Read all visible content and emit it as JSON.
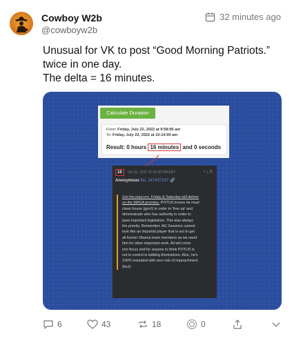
{
  "author": {
    "display_name": "Cowboy W2b",
    "handle": "@cowboyw2b"
  },
  "timestamp": "32 minutes ago",
  "post_text": {
    "line1": "Unusual for VK to post “Good Morning Patriots.”",
    "line2": "twice in one day.",
    "line3": "The delta = 16 minutes."
  },
  "calculator": {
    "button_label": "Calculate Duration",
    "from_label": "From:",
    "from_value": "Friday, July 22, 2022 at 9:58:00 am",
    "to_label": "To:",
    "to_value": "Friday, July 22, 2022 at 10:14:00 am",
    "result_prefix": "Result: 0 hours",
    "result_minutes": "16 minutes",
    "result_suffix": "and 0 seconds"
  },
  "qpost": {
    "number": "16",
    "meta": "Oct 31, 2017 11:31:00 PM EDT",
    "author": "Anonymous",
    "id": "No. 147437247",
    "body": [
      "Get the popcorn, Friday & Saturday will deliver",
      "on the MAGA promise. POTUS knows he must",
      "clean house (gov't) in order to 'free up' and",
      "demonstrate who has authority in order to",
      "pass important legislation. This was always",
      "the priority. Remember, AG Sessions cannot",
      "look like an impartial player that is out to get",
      "all former Obama team members as we need",
      "him for other important work. All will come",
      "into focus and for anyone to think POTUS is",
      "not in control is kidding themselves. Also, he's",
      "100% insulated with zero risk of impeachment",
      "(fact)."
    ]
  },
  "actions": {
    "replies": "6",
    "likes": "43",
    "reposts": "18",
    "quotes": "0"
  },
  "colors": {
    "media_bg": "#2b4d9e",
    "calc_button": "#6bb241",
    "highlight": "#d63a3a"
  }
}
